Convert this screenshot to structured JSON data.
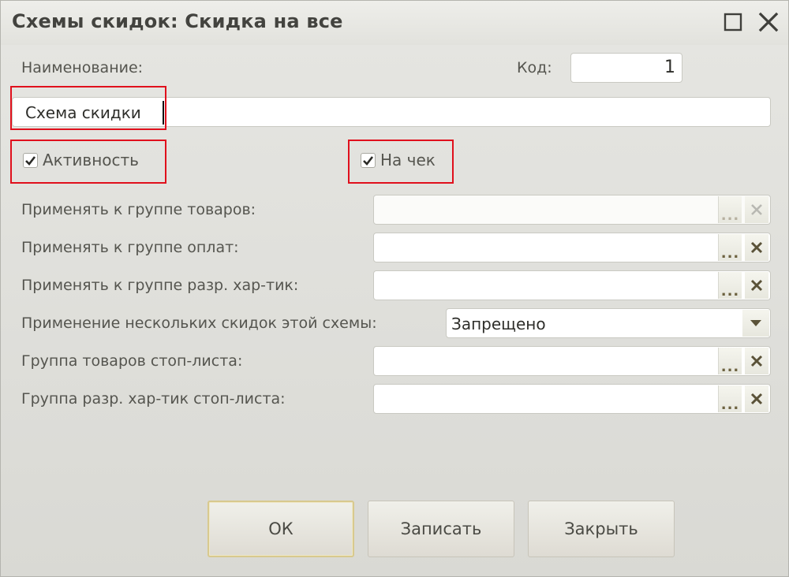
{
  "window": {
    "title": "Схемы скидок: Скидка на все"
  },
  "form": {
    "name_label": "Наименование:",
    "code_label": "Код:",
    "code_value": "1",
    "name_value": "Схема скидки",
    "active_label": "Активность",
    "active_checked": true,
    "receipt_label": "На чек",
    "receipt_checked": true,
    "rows": [
      {
        "label": "Применять к группе товаров:",
        "value": "",
        "select_label": "...",
        "clear_label": "×"
      },
      {
        "label": "Применять к группе оплат:",
        "value": "",
        "select_label": "...",
        "clear_label": "×"
      },
      {
        "label": "Применять к группе разр. хар-тик:",
        "value": "",
        "select_label": "...",
        "clear_label": "×"
      },
      {
        "label": "Применение нескольких скидок этой схемы:",
        "value": "Запрещено"
      },
      {
        "label": "Группа товаров стоп-листа:",
        "value": "",
        "select_label": "...",
        "clear_label": "×"
      },
      {
        "label": "Группа разр. хар-тик стоп-листа:",
        "value": "",
        "select_label": "...",
        "clear_label": "×"
      }
    ]
  },
  "buttons": {
    "ok": "ОК",
    "save": "Записать",
    "close": "Закрыть"
  },
  "colors": {
    "highlight": "#e0101c",
    "icon_dark": "#5a5238",
    "icon_light": "#b8b8b2"
  }
}
